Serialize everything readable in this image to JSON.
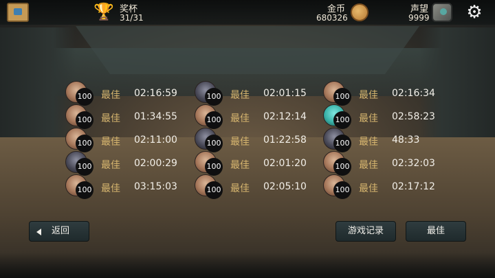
{
  "hud": {
    "trophy_label": "奖杯",
    "trophy_value": "31/31",
    "gold_label": "金币",
    "gold_value": "680326",
    "reputation_label": "声望",
    "reputation_value": "9999"
  },
  "records": {
    "level_badge": "100",
    "best_label": "最佳",
    "columns": [
      [
        {
          "time": "02:16:59",
          "avatar": "light"
        },
        {
          "time": "01:34:55",
          "avatar": "light"
        },
        {
          "time": "02:11:00",
          "avatar": "light"
        },
        {
          "time": "02:00:29",
          "avatar": "dark"
        },
        {
          "time": "03:15:03",
          "avatar": "light"
        }
      ],
      [
        {
          "time": "02:01:15",
          "avatar": "dark"
        },
        {
          "time": "02:12:14",
          "avatar": "light"
        },
        {
          "time": "01:22:58",
          "avatar": "dark"
        },
        {
          "time": "02:01:20",
          "avatar": "light"
        },
        {
          "time": "02:05:10",
          "avatar": "light"
        }
      ],
      [
        {
          "time": "02:16:34",
          "avatar": "light"
        },
        {
          "time": "02:58:23",
          "avatar": "teal"
        },
        {
          "time": "48:33",
          "avatar": "dark"
        },
        {
          "time": "02:32:03",
          "avatar": "light"
        },
        {
          "time": "02:17:12",
          "avatar": "light"
        }
      ]
    ]
  },
  "buttons": {
    "back": "返回",
    "game_records": "游戏记录",
    "best": "最佳"
  }
}
